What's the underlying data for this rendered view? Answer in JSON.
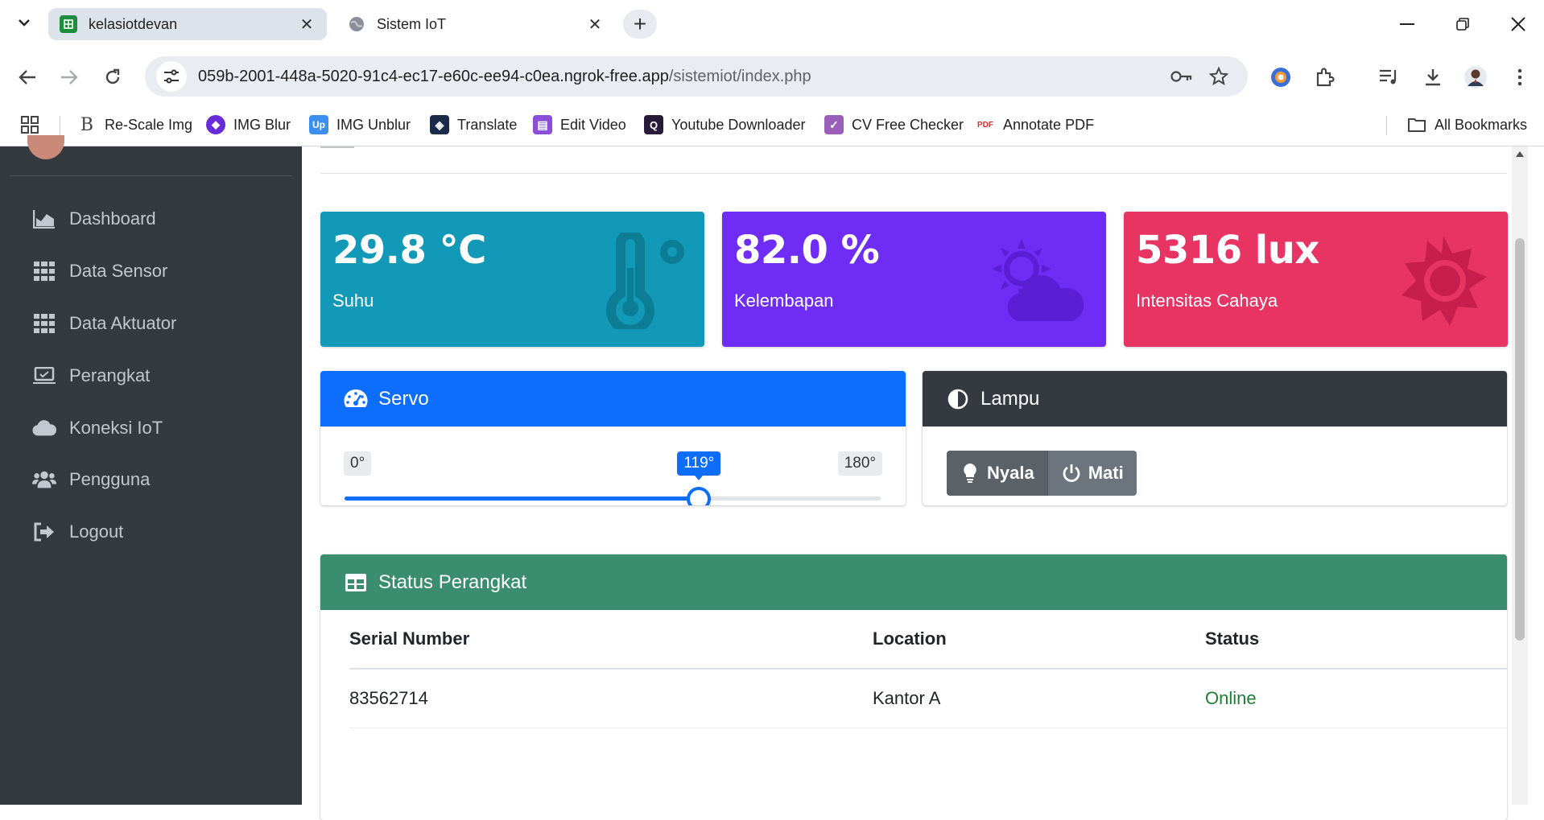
{
  "browser": {
    "tabs": [
      {
        "title": "kelasiotdevan",
        "active": true
      },
      {
        "title": "Sistem IoT",
        "active": false
      }
    ],
    "new_tab": "+",
    "url_host": "059b-2001-448a-5020-91c4-ec17-e60c-ee94-c0ea.ngrok-free.app",
    "url_path": "/sistemiot/index.php",
    "bookmarks": [
      {
        "label": "Re-Scale Img",
        "icon": "B"
      },
      {
        "label": "IMG Blur",
        "icon": "◆"
      },
      {
        "label": "IMG Unblur",
        "icon": "Up"
      },
      {
        "label": "Translate",
        "icon": "◈"
      },
      {
        "label": "Edit Video",
        "icon": "▤"
      },
      {
        "label": "Youtube Downloader",
        "icon": "Q"
      },
      {
        "label": "CV Free Checker",
        "icon": "✓"
      },
      {
        "label": "Annotate PDF",
        "icon": "PDF"
      }
    ],
    "all_bookmarks": "All Bookmarks"
  },
  "sidebar": {
    "items": [
      {
        "label": "Dashboard",
        "icon": "chart-area-icon"
      },
      {
        "label": "Data Sensor",
        "icon": "table-grid-icon"
      },
      {
        "label": "Data Aktuator",
        "icon": "table-grid-icon"
      },
      {
        "label": "Perangkat",
        "icon": "laptop-icon"
      },
      {
        "label": "Koneksi IoT",
        "icon": "cloud-icon"
      },
      {
        "label": "Pengguna",
        "icon": "users-icon"
      },
      {
        "label": "Logout",
        "icon": "sign-out-icon"
      }
    ]
  },
  "info_boxes": [
    {
      "value": "29.8 °C",
      "label": "Suhu",
      "color": "#1199b7",
      "icon": "thermometer-icon"
    },
    {
      "value": "82.0 %",
      "label": "Kelembapan",
      "color": "#6f2cf5",
      "icon": "cloud-sun-icon"
    },
    {
      "value": "5316 lux",
      "label": "Intensitas Cahaya",
      "color": "#e83463",
      "icon": "sun-icon"
    }
  ],
  "servo": {
    "title": "Servo",
    "min_label": "0°",
    "max_label": "180°",
    "value_label": "119°",
    "min": 0,
    "max": 180,
    "value": 119,
    "color": "#0d6efd"
  },
  "lampu": {
    "title": "Lampu",
    "on_label": "Nyala",
    "off_label": "Mati",
    "color": "#343a40"
  },
  "status": {
    "title": "Status Perangkat",
    "color": "#3a8e6f",
    "columns": [
      "Serial Number",
      "Location",
      "Status"
    ],
    "rows": [
      {
        "serial": "83562714",
        "location": "Kantor A",
        "status": "Online"
      }
    ]
  }
}
